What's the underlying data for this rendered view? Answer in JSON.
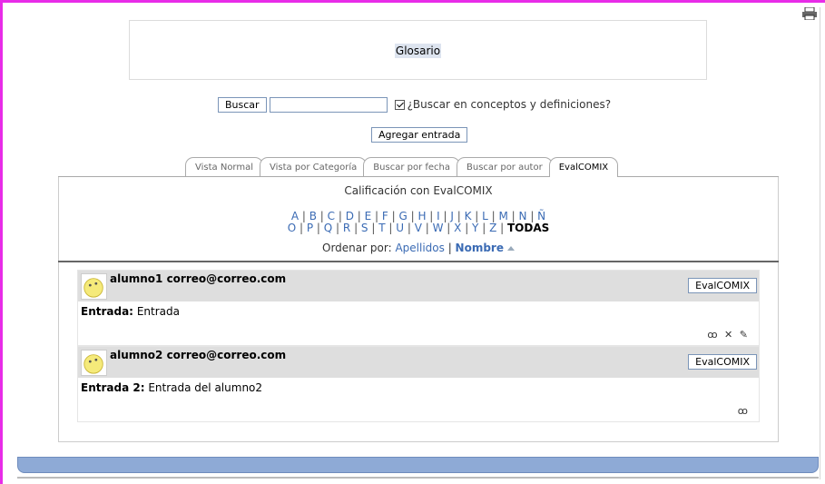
{
  "page": {
    "glossary_title": "Glosario"
  },
  "search": {
    "button": "Buscar",
    "input_value": "",
    "checkbox_label": "¿Buscar en conceptos y definiciones?",
    "checkbox_checked": true
  },
  "add_entry_button": "Agregar entrada",
  "tabs": [
    {
      "label": "Vista Normal"
    },
    {
      "label": "Vista por Categoría"
    },
    {
      "label": "Buscar por fecha"
    },
    {
      "label": "Buscar por autor"
    },
    {
      "label": "EvalCOMIX",
      "active": true
    }
  ],
  "panel": {
    "title": "Calificación con EvalCOMIX",
    "letters_row1": [
      "A",
      "B",
      "C",
      "D",
      "E",
      "F",
      "G",
      "H",
      "I",
      "J",
      "K",
      "L",
      "M",
      "N",
      "Ñ"
    ],
    "letters_row2": [
      "O",
      "P",
      "Q",
      "R",
      "S",
      "T",
      "U",
      "V",
      "W",
      "X",
      "Y",
      "Z"
    ],
    "all_label": "TODAS",
    "order_label": "Ordenar por:",
    "order_surname": "Apellidos",
    "order_name": "Nombre"
  },
  "entries": [
    {
      "author": "alumno1 correo@correo.com",
      "eval_button": "EvalCOMIX",
      "label": "Entrada:",
      "text": "Entrada",
      "icons": "ꝏ ✕ ✎"
    },
    {
      "author": "alumno2 correo@correo.com",
      "eval_button": "EvalCOMIX",
      "label": "Entrada 2:",
      "text": "Entrada del alumno2",
      "icons": "ꝏ"
    }
  ],
  "colors": {
    "accent": "#e82ce8",
    "link": "#3b6bb4",
    "footer": "#8eaad6"
  }
}
